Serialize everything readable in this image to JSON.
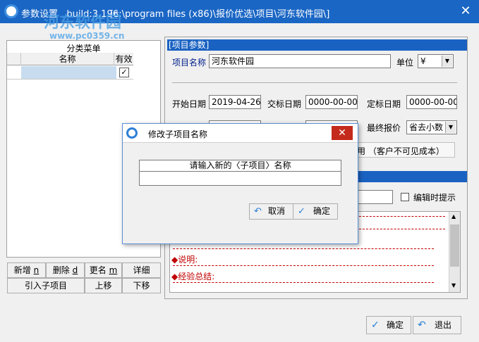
{
  "window": {
    "title": "参数设置",
    "build": "build:3.196",
    "path": "[c:\\program files (x86)\\报价优选\\项目\\河东软件园\\]",
    "watermark_cn": "河东软件园",
    "watermark_url": "www.pc0359.cn"
  },
  "left": {
    "caption": "分类菜单",
    "col_name": "名称",
    "col_valid": "有效",
    "check_mark": "✓",
    "buttons": {
      "add": "新增",
      "add_key": "n",
      "delete": "删除",
      "delete_key": "d",
      "rename": "更名",
      "rename_key": "m",
      "detail": "详细",
      "import_sub": "引入子项目",
      "move_up": "上移",
      "move_down": "下移"
    }
  },
  "params": {
    "header": "[项目参数]",
    "project_name_label": "项目名称",
    "project_name_value": "河东软件园",
    "unit_label": "单位",
    "unit_value": "¥",
    "start_date_label": "开始日期",
    "start_date_value": "2019-04-26",
    "bid_date_label": "交标日期",
    "bid_date_value": "0000-00-00",
    "award_date_label": "定标日期",
    "award_date_value": "0000-00-00",
    "final_price_label": "最终报价",
    "final_price_value": "省去小数",
    "cost_note": "用 （客户不可见成本）",
    "edit_hint_label": "编辑时提示"
  },
  "textarea": {
    "line_label_partial": "·······",
    "note_label": "◆说明:",
    "summary_label": "◆经验总结:"
  },
  "dialog": {
    "title": "修改子项目名称",
    "prompt": "请输入新的〈子项目〉名称",
    "input_value": "",
    "cancel_label": "取消",
    "ok_label": "确定"
  },
  "bottom": {
    "ok_label": "确定",
    "exit_label": "退出"
  },
  "colors": {
    "titlebar": "#1a66c5",
    "section_bar": "#1a62c2",
    "accent_red": "#c00000",
    "label_blue": "#00208a"
  },
  "icons": {
    "app": "app-logo-icon",
    "close": "close-icon",
    "check": "checkmark-icon",
    "undo": "undo-arrow-icon",
    "dropdown": "dropdown-arrow-icon"
  }
}
